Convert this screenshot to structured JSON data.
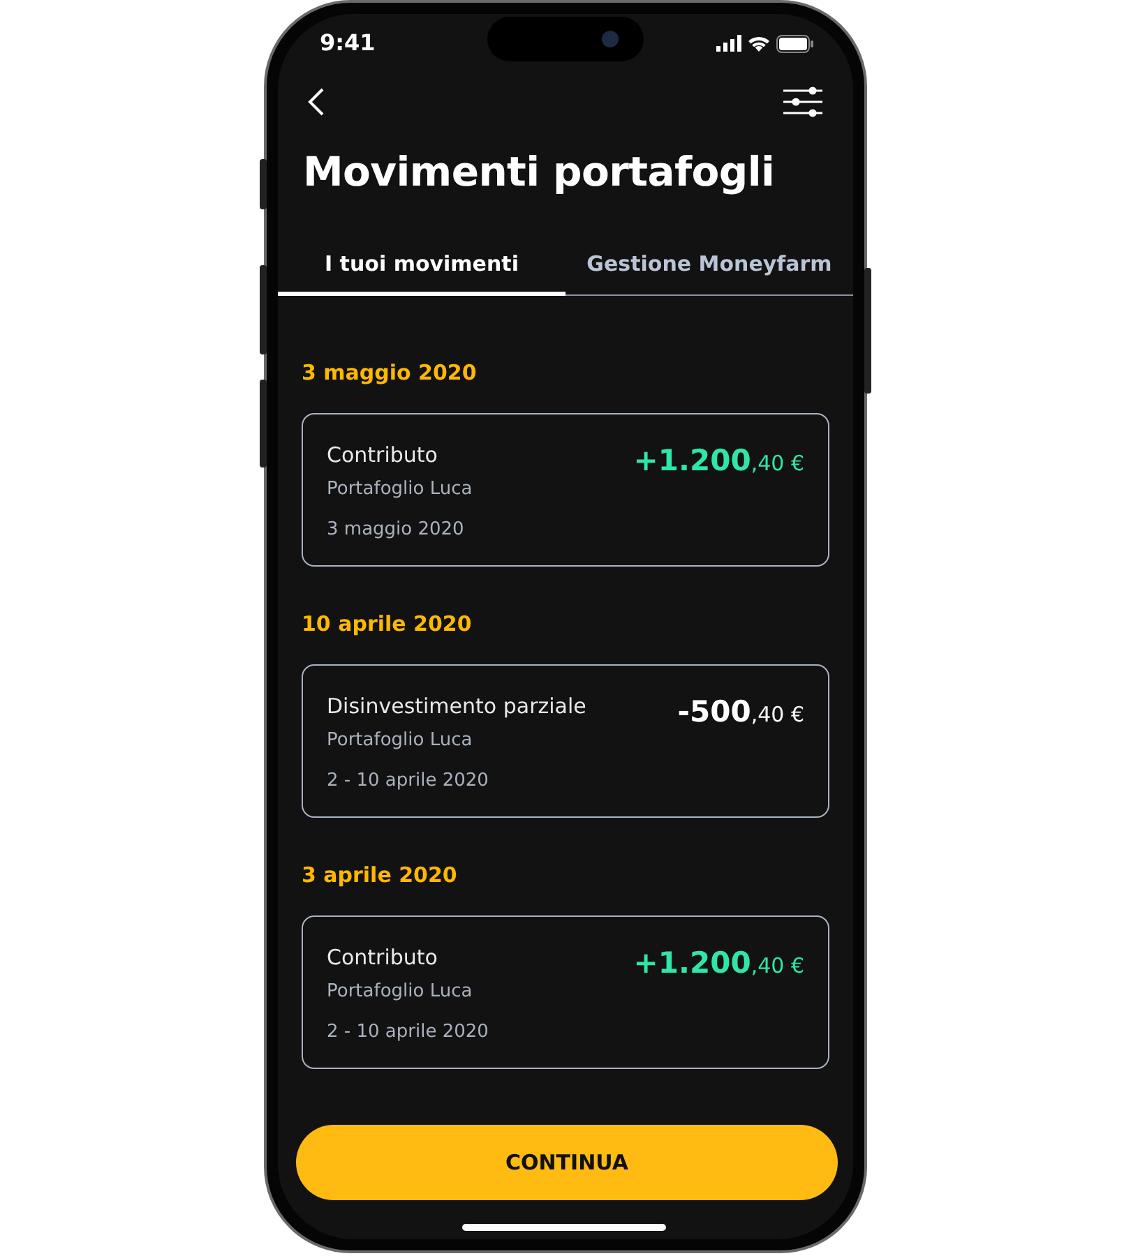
{
  "status_bar": {
    "time": "9:41"
  },
  "header": {
    "title": "Movimenti portafogli"
  },
  "tabs": [
    {
      "label": "I tuoi movimenti",
      "selected": true
    },
    {
      "label": "Gestione Moneyfarm",
      "selected": false
    }
  ],
  "groups": [
    {
      "date": "3 maggio 2020",
      "movements": [
        {
          "title": "Contributo",
          "portfolio": "Portafoglio Luca",
          "period": "3 maggio 2020",
          "kind": "credit",
          "amount_main": "+1.200",
          "amount_decimals": ",40 €"
        }
      ]
    },
    {
      "date": "10 aprile 2020",
      "movements": [
        {
          "title": "Disinvestimento parziale",
          "portfolio": "Portafoglio Luca",
          "period": "2 - 10 aprile 2020",
          "kind": "debit",
          "amount_main": "-500",
          "amount_decimals": ",40 €"
        }
      ]
    },
    {
      "date": "3 aprile 2020",
      "movements": [
        {
          "title": "Contributo",
          "portfolio": "Portafoglio Luca",
          "period": "2 - 10 aprile 2020",
          "kind": "credit",
          "amount_main": "+1.200",
          "amount_decimals": ",40 €"
        }
      ]
    }
  ],
  "primary_button": "CONTINUA"
}
